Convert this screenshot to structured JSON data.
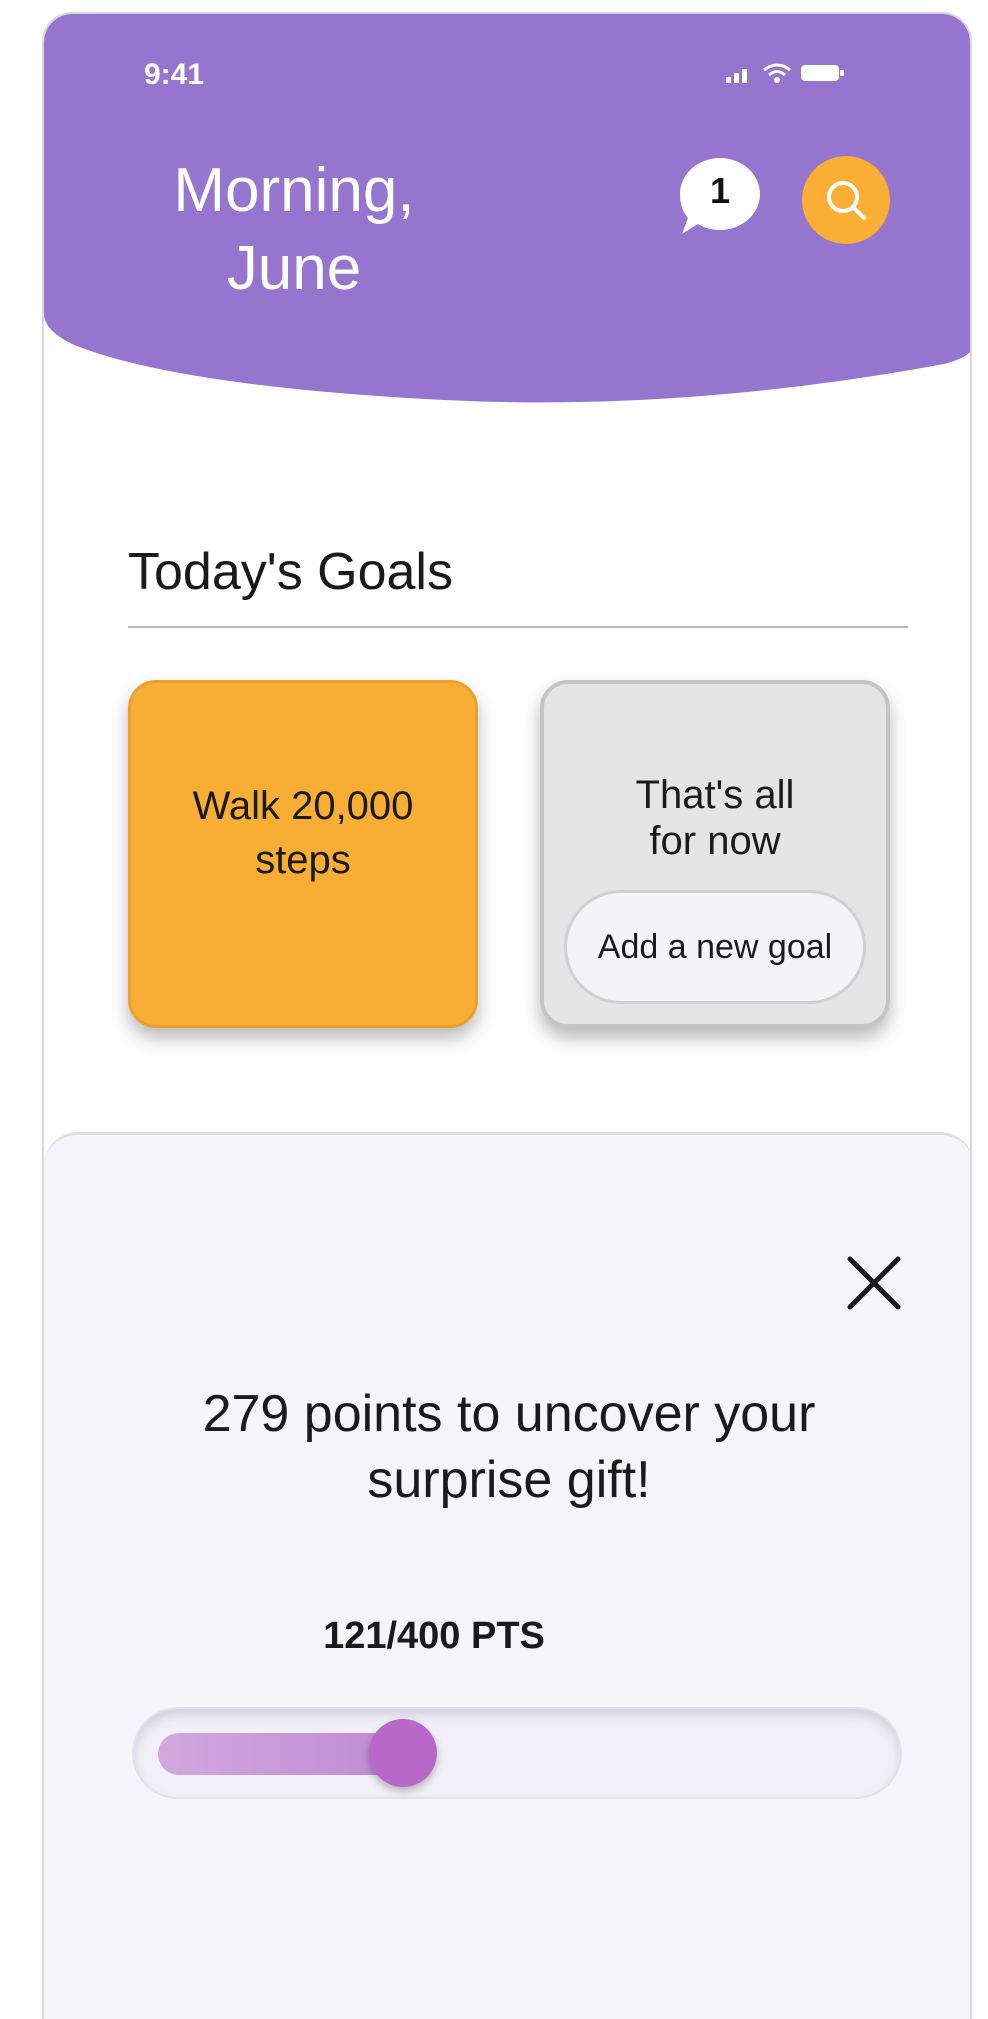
{
  "status_bar": {
    "time": "9:41"
  },
  "header": {
    "greeting_line1": "Morning,",
    "greeting_line2": "June",
    "message_count": "1",
    "accent_color": "#9575cd",
    "search_color": "#f9ae35"
  },
  "goals": {
    "section_title": "Today's Goals",
    "items": [
      {
        "label_line1": "Walk 20,000",
        "label_line2": "steps",
        "color": "#f8ae35"
      }
    ],
    "empty_card": {
      "label_line1": "That's all",
      "label_line2": "for now",
      "add_button_label": "Add a new goal"
    }
  },
  "reward_sheet": {
    "message_line1": "279 points to uncover your",
    "message_line2": "surprise gift!",
    "points_label": "121/400 PTS",
    "points_current": 121,
    "points_total": 400
  }
}
